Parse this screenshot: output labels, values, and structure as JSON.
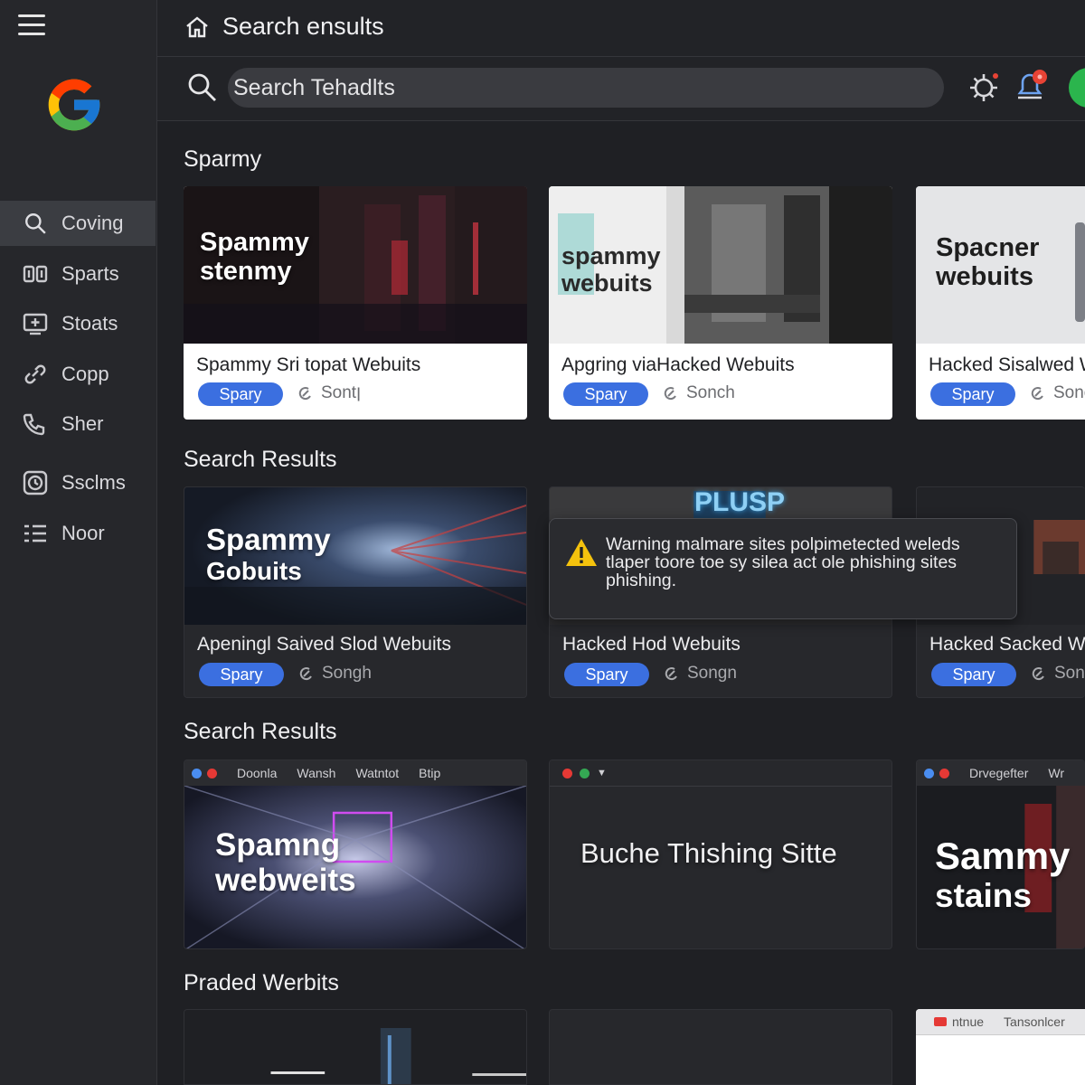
{
  "app": {
    "title": "Search ensults"
  },
  "search": {
    "placeholder": "Search Tehadlts"
  },
  "sidebar": {
    "items": [
      {
        "label": "Coving",
        "icon": "search-icon",
        "active": true
      },
      {
        "label": "Sparts",
        "icon": "sports-icon"
      },
      {
        "label": "Stoats",
        "icon": "stats-icon"
      },
      {
        "label": "Copp",
        "icon": "link-icon"
      },
      {
        "label": "Sher",
        "icon": "phone-icon"
      },
      {
        "label": "Ssclms",
        "icon": "clock-icon"
      },
      {
        "label": "Noor",
        "icon": "list-icon"
      }
    ]
  },
  "sections": [
    {
      "title": "Sparmy",
      "cards": [
        {
          "overlay": [
            "Spammy",
            "stenmy"
          ],
          "title": "Spammy Sri topat Webuits",
          "chip": "Spary",
          "meta": "Sontן"
        },
        {
          "overlay": [
            "spammy",
            "webuits"
          ],
          "title": "Apgring viaHacked Webuits",
          "chip": "Spary",
          "meta": "Sonch"
        },
        {
          "overlay": [
            "Spacner",
            "webuits"
          ],
          "title": "Hacked Sisalwed Webuits",
          "chip": "Spary",
          "meta": "Sonch"
        }
      ]
    },
    {
      "title": "Search Results",
      "cards": [
        {
          "overlay": [
            "Spammy",
            "Gobuits"
          ],
          "title": "Apeningl Saived Slod Webuits",
          "chip": "Spary",
          "meta": "Songh"
        },
        {
          "overlay": [
            "PLUSP"
          ],
          "title": "Hacked Hod Webuits",
          "chip": "Spary",
          "meta": "Songn"
        },
        {
          "overlay": [],
          "title": "Hacked Sacked Webuits",
          "chip": "Spary",
          "meta": "Songn"
        }
      ]
    },
    {
      "title": "Search Results",
      "cards": [
        {
          "tabs": [
            "Doonla",
            "Wansh",
            "Watntot",
            "Btip"
          ],
          "overlay": [
            "Spamng",
            "webweits"
          ]
        },
        {
          "tabs": [],
          "overlay": [
            "Buche Thishing Sitte"
          ]
        },
        {
          "tabs": [
            "Drvegefter",
            "Wr"
          ],
          "overlay": [
            "Sammy",
            "stains"
          ]
        }
      ]
    },
    {
      "title": "Praded Werbits",
      "cards": [
        {
          "tabs": []
        },
        {
          "tabs": []
        },
        {
          "tabs": [
            "ntnue",
            "Tansonlcer"
          ]
        }
      ]
    }
  ],
  "warning": {
    "text": "Warning malmare sites polpimetected weleds tlaper toore toe sy silea act ole phishing sites phishing."
  },
  "colors": {
    "accent": "#3b6fe0",
    "background": "#1f2024",
    "sidebar": "#26272b",
    "warning": "#f4c20d"
  }
}
